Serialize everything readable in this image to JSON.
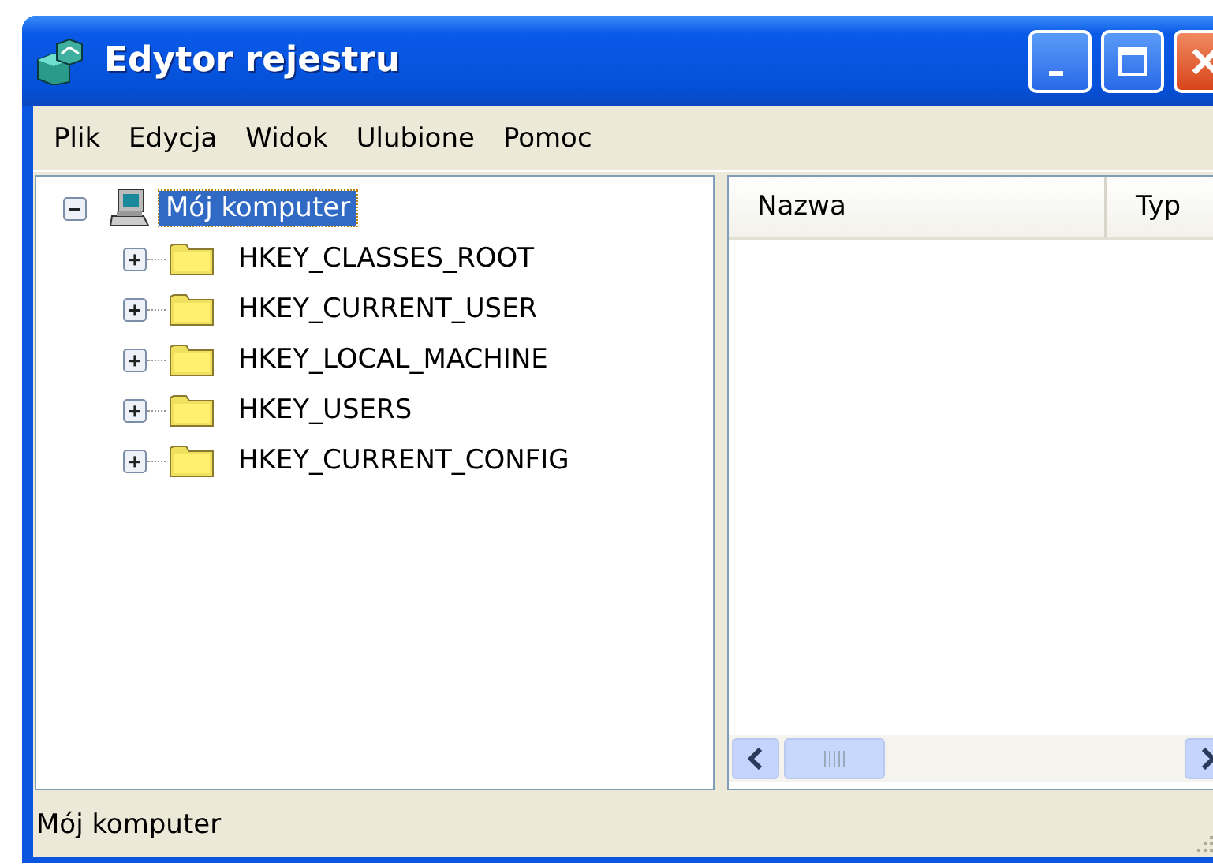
{
  "window": {
    "title": "Edytor rejestru"
  },
  "menu": [
    "Plik",
    "Edycja",
    "Widok",
    "Ulubione",
    "Pomoc"
  ],
  "tree": {
    "label": "Mój komputer",
    "selected": true,
    "expanded": true,
    "children": [
      {
        "label": "HKEY_CLASSES_ROOT",
        "selected": false,
        "expanded": false
      },
      {
        "label": "HKEY_CURRENT_USER",
        "selected": false,
        "expanded": false
      },
      {
        "label": "HKEY_LOCAL_MACHINE",
        "selected": false,
        "expanded": false
      },
      {
        "label": "HKEY_USERS",
        "selected": false,
        "expanded": false
      },
      {
        "label": "HKEY_CURRENT_CONFIG",
        "selected": false,
        "expanded": false
      }
    ]
  },
  "list": {
    "columns": [
      "Nazwa",
      "Typ"
    ]
  },
  "status_bar": "Mój komputer"
}
